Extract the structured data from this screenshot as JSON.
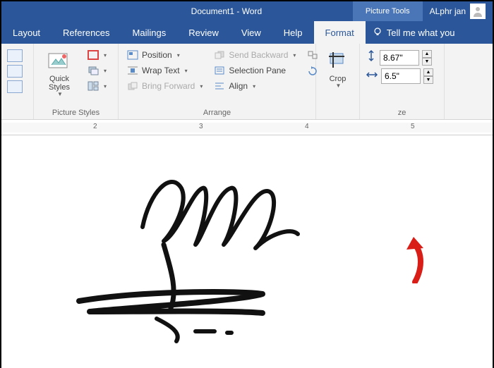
{
  "titlebar": {
    "document": "Document1  -  Word",
    "contextual_tab": "Picture Tools",
    "user_name": "ALphr jan"
  },
  "tabs": {
    "layout": "Layout",
    "references": "References",
    "mailings": "Mailings",
    "review": "Review",
    "view": "View",
    "help": "Help",
    "format": "Format",
    "tellme": "Tell me what you"
  },
  "ribbon": {
    "picture_styles": {
      "quick_styles": "Quick\nStyles",
      "group_label": "Picture Styles"
    },
    "arrange": {
      "position": "Position",
      "wrap_text": "Wrap Text",
      "bring_forward": "Bring Forward",
      "send_backward": "Send Backward",
      "selection_pane": "Selection Pane",
      "align": "Align",
      "group_label": "Arrange"
    },
    "size": {
      "crop": "Crop",
      "height_value": "8.67\"",
      "width_value": "6.5\"",
      "group_label": "ze"
    }
  },
  "ruler": {
    "marks": [
      "2",
      "3",
      "4",
      "5"
    ]
  }
}
